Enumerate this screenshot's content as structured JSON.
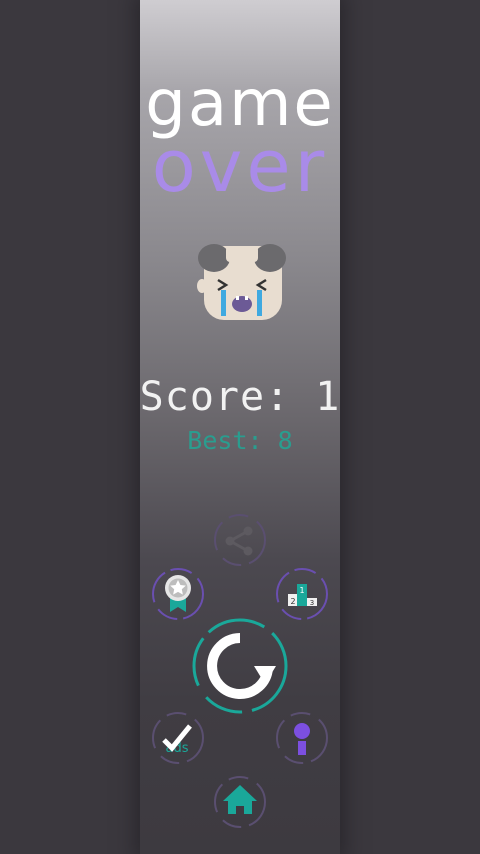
{
  "game": {
    "title_line1": "game",
    "title_line2": "over",
    "score_label": "Score:",
    "score_value": "1",
    "best_label": "Best:",
    "best_value": "8"
  },
  "buttons": {
    "share": {
      "icon": "share-icon"
    },
    "achievements": {
      "icon": "ribbon-medal-icon"
    },
    "leaderboard": {
      "icon": "podium-icon",
      "ranks": [
        "2",
        "1",
        "3"
      ]
    },
    "restart": {
      "icon": "restart-arrow-icon"
    },
    "ads": {
      "icon": "checkmark-icon",
      "label": "ads"
    },
    "info": {
      "icon": "info-icon"
    },
    "home": {
      "icon": "home-icon"
    }
  },
  "colors": {
    "background": "#3b383e",
    "accent_purple": "#a98be8",
    "accent_teal": "#1aa89a",
    "white": "#ffffff"
  }
}
